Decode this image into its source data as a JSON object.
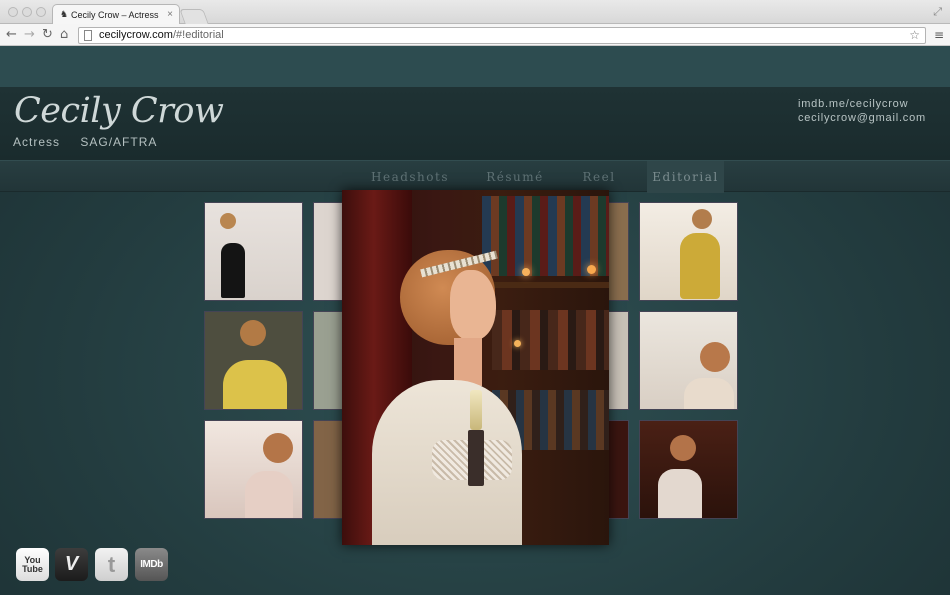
{
  "browser": {
    "tab_title": "Cecily Crow – Actress",
    "url_host": "cecilycrow.com",
    "url_path": "/#!editorial",
    "tab_favicon": "bird-icon"
  },
  "site": {
    "logo": "Cecily Crow",
    "role": "Actress",
    "union": "SAG/AFTRA",
    "imdb": "imdb.me/cecilycrow",
    "email": "cecilycrow@gmail.com"
  },
  "nav": {
    "items": [
      {
        "label": "Headshots",
        "active": false
      },
      {
        "label": "Résumé",
        "active": false
      },
      {
        "label": "Reel",
        "active": false
      },
      {
        "label": "Editorial",
        "active": true
      }
    ]
  },
  "gallery": {
    "thumbnails": 12,
    "lightbox_open": true
  },
  "social": {
    "youtube": "You Tube",
    "vimeo": "V",
    "twitter": "t",
    "imdb": "IMDb"
  },
  "colors": {
    "page_bg": "#2f4a4d",
    "header_bg": "#1a2b2d",
    "nav_text": "#5f7275",
    "logo_text": "#cfd8d8"
  }
}
